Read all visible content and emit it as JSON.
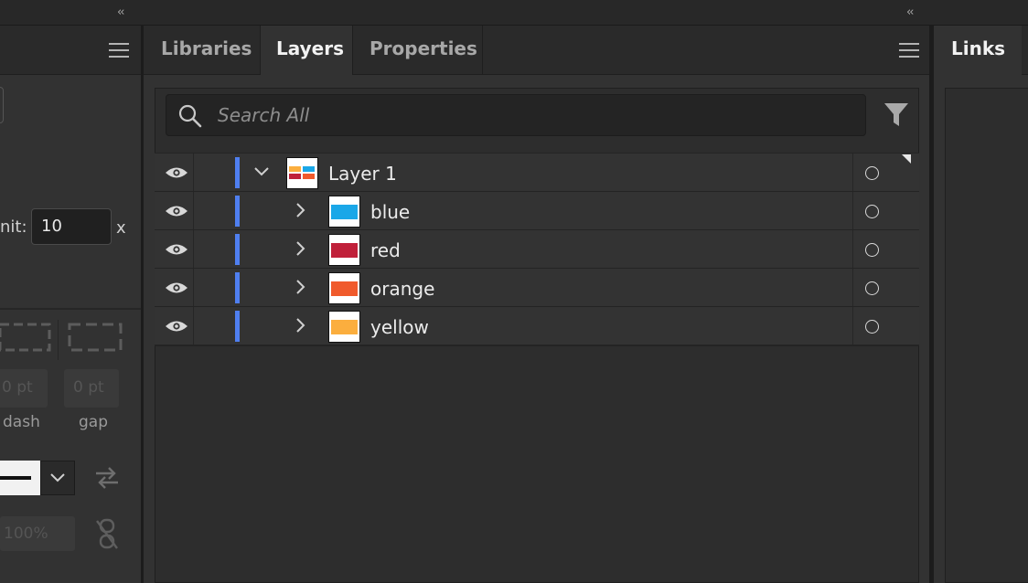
{
  "top_strip": {
    "collapse_left_glyph": "‹‹",
    "collapse_right_glyph": "‹‹"
  },
  "stroke_panel": {
    "menu_icon": "hamburger-icon",
    "miter_limit_label": "nit:",
    "miter_limit_value": "10",
    "miter_limit_suffix": "x",
    "dash_field_value": "0 pt",
    "gap_field_value": "0 pt",
    "dash_label": "dash",
    "gap_label": "gap",
    "opacity_value": "100%",
    "icons": [
      "dash-corners-icon",
      "swap-arrows-icon",
      "unlink-icon"
    ]
  },
  "layers_panel": {
    "tabs": [
      {
        "label": "Libraries",
        "active": false
      },
      {
        "label": "Layers",
        "active": true
      },
      {
        "label": "Properties",
        "active": false
      }
    ],
    "search_placeholder": "Search All",
    "rows": [
      {
        "name": "Layer 1",
        "expanded": true,
        "level": 0,
        "visible": true
      },
      {
        "name": "blue",
        "expanded": false,
        "level": 1,
        "visible": true,
        "color": "#1aa7e8"
      },
      {
        "name": "red",
        "expanded": false,
        "level": 1,
        "visible": true,
        "color": "#c0203a"
      },
      {
        "name": "orange",
        "expanded": false,
        "level": 1,
        "visible": true,
        "color": "#f05a2c"
      },
      {
        "name": "yellow",
        "expanded": false,
        "level": 1,
        "visible": true,
        "color": "#fbae3e"
      }
    ],
    "layer_color": "#4f7ff0"
  },
  "links_panel": {
    "tab_label": "Links"
  }
}
